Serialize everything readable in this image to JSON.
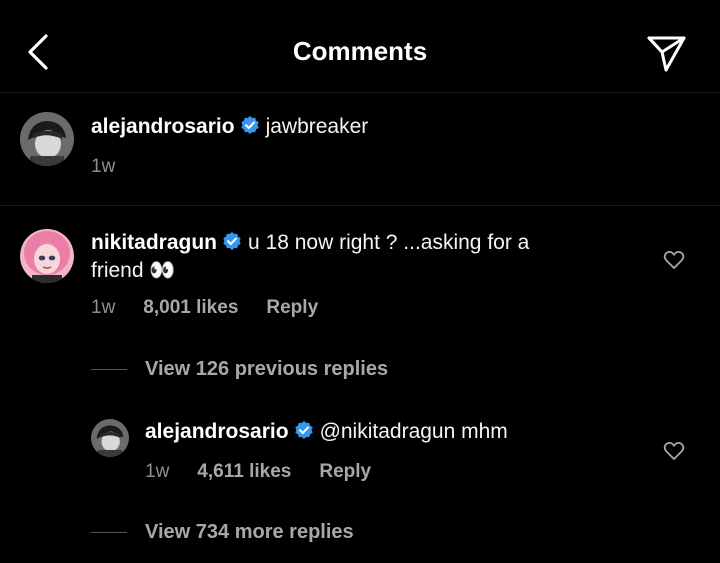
{
  "header": {
    "title": "Comments",
    "back_icon": "chevron-left-icon",
    "send_icon": "paper-plane-icon"
  },
  "caption": {
    "username": "alejandrosario",
    "text": "jawbreaker",
    "time": "1w",
    "verified": true
  },
  "comment": {
    "username": "nikitadragun",
    "text_line1": "u 18 now right ? ...asking for a",
    "text_line2": "friend 👀",
    "time": "1w",
    "likes": "8,001 likes",
    "reply_label": "Reply",
    "verified": true
  },
  "view_previous": "View 126 previous replies",
  "reply": {
    "username": "alejandrosario",
    "text": "@nikitadragun mhm",
    "time": "1w",
    "likes": "4,611 likes",
    "reply_label": "Reply",
    "verified": true
  },
  "view_more": "View 734 more replies",
  "colors": {
    "background": "#000000",
    "text": "#f5f5f5",
    "muted": "#8e8e8e",
    "verified": "#3797f0"
  }
}
